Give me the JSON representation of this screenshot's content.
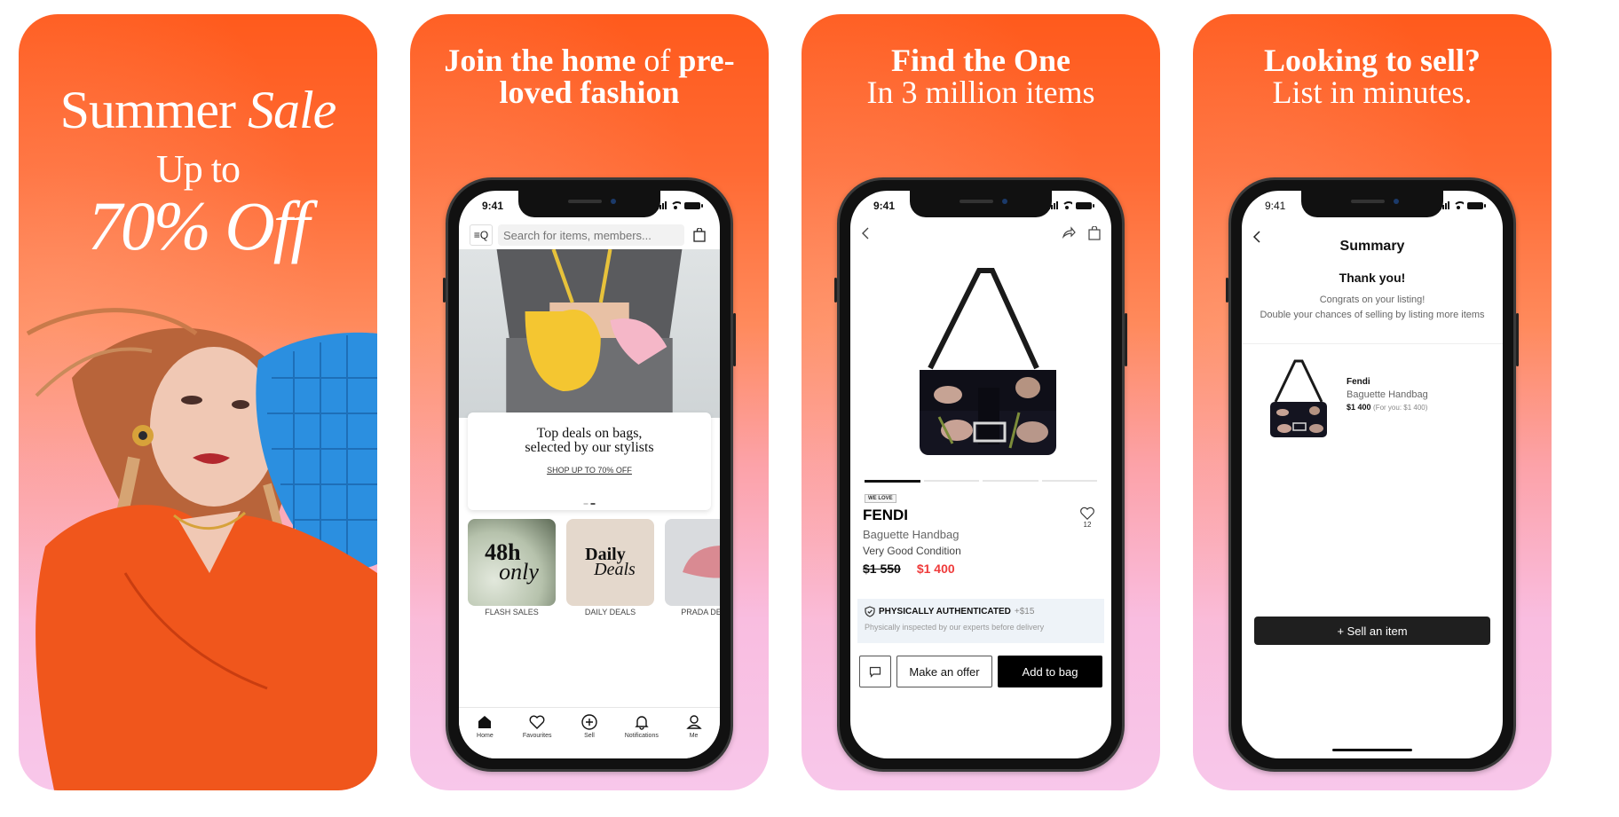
{
  "screens": [
    {
      "id": "summer-sale",
      "headline": {
        "line1_regular": "Summer",
        "line1_italic": "Sale",
        "line2": "Up to",
        "line3": "70% Off"
      }
    },
    {
      "id": "home",
      "headline": {
        "line1_bold_a": "Join the home",
        "line1_regular": " of ",
        "line1_bold_b": "pre-",
        "line2": "loved fashion"
      },
      "phone": {
        "time": "9:41",
        "search_placeholder": "Search for items, members...",
        "filter_icon": "≡Q",
        "deal_card": {
          "title_line1": "Top deals on bags,",
          "title_line2": "selected by our stylists",
          "link": "SHOP UP TO 70% OFF"
        },
        "tiles": [
          {
            "art_line1": "48h",
            "art_line2": "only",
            "label": "FLASH SALES"
          },
          {
            "art_line1": "Daily",
            "art_line2": "Deals",
            "label": "DAILY DEALS"
          },
          {
            "art_line1": "",
            "art_line2": "",
            "label": "PRADA DEALS"
          }
        ],
        "tabbar": [
          {
            "icon": "home-icon",
            "label": "Home"
          },
          {
            "icon": "heart-icon",
            "label": "Favourites"
          },
          {
            "icon": "plus-circle-icon",
            "label": "Sell"
          },
          {
            "icon": "bell-icon",
            "label": "Notifications"
          },
          {
            "icon": "user-icon",
            "label": "Me"
          }
        ]
      }
    },
    {
      "id": "product",
      "headline": {
        "line1": "Find the One",
        "line2": "In 3 million items"
      },
      "phone": {
        "time": "9:41",
        "badge": "WE LOVE",
        "brand": "FENDI",
        "product_name": "Baguette Handbag",
        "condition": "Very Good Condition",
        "old_price": "$1 550",
        "new_price": "$1 400",
        "likes": "12",
        "auth_title": "PHYSICALLY AUTHENTICATED",
        "auth_price": "+$15",
        "auth_desc": "Physically inspected by our experts before delivery",
        "offer_button": "Make an offer",
        "add_button": "Add to bag"
      }
    },
    {
      "id": "sell",
      "headline": {
        "line1": "Looking to sell?",
        "line2": "List in minutes."
      },
      "phone": {
        "time": "9:41",
        "title": "Summary",
        "thanks": "Thank you!",
        "congrats_line1": "Congrats on your listing!",
        "congrats_line2": "Double your chances of selling by listing more items",
        "item_brand": "Fendi",
        "item_name": "Baguette Handbag",
        "item_price": "$1 400",
        "item_foryou": "(For you: $1 400)",
        "sell_button": "+ Sell an item"
      }
    }
  ],
  "colors": {
    "accent_orange": "#ff5a1c",
    "accent_pink": "#f8c7ea",
    "sale_red": "#ef3b3b"
  }
}
